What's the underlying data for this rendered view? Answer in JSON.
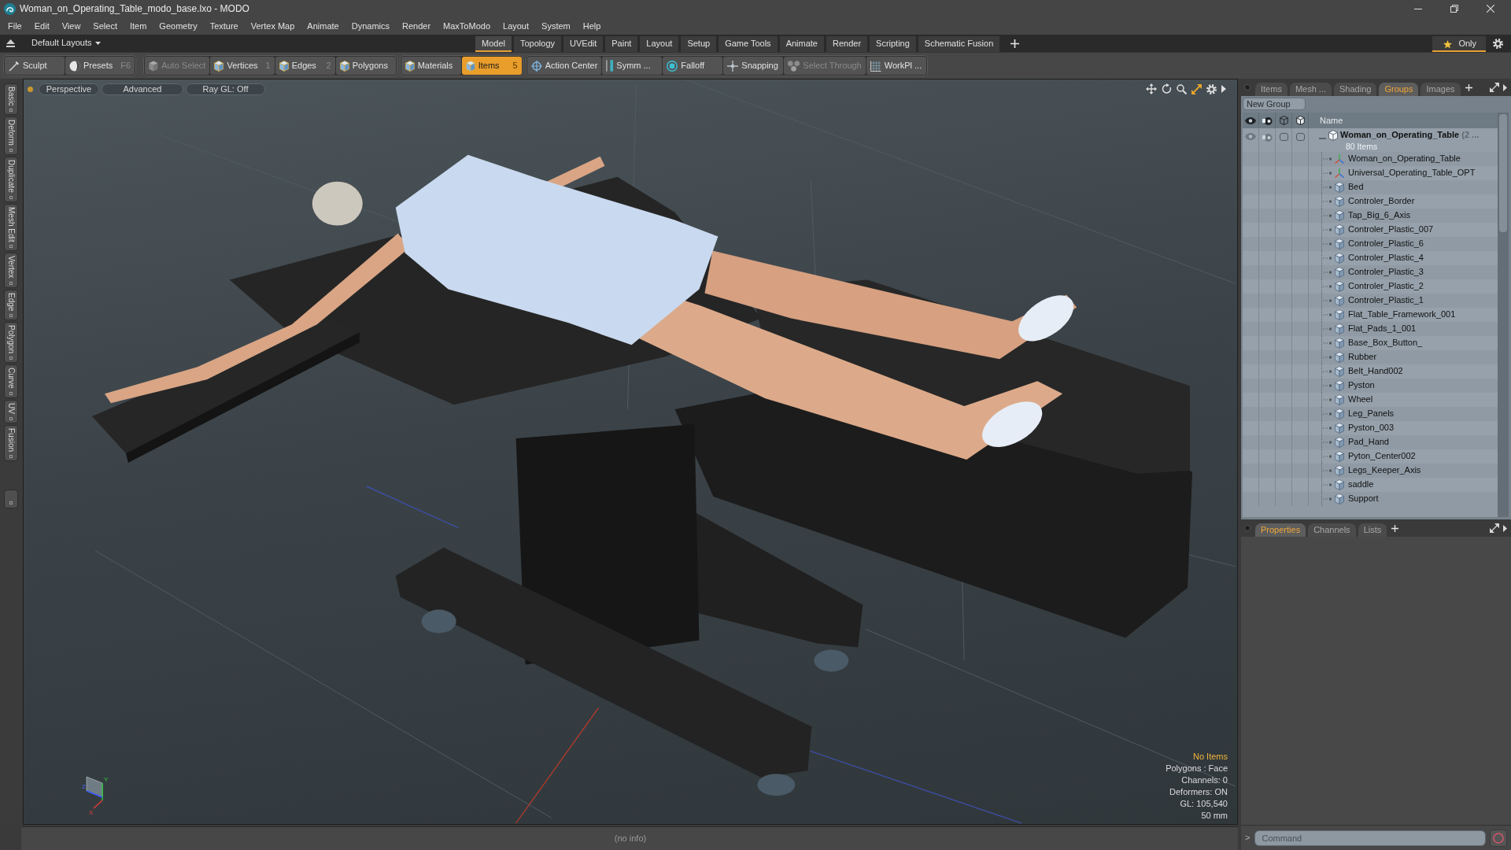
{
  "window": {
    "title": "Woman_on_Operating_Table_modo_base.lxo - MODO"
  },
  "menu": [
    "File",
    "Edit",
    "View",
    "Select",
    "Item",
    "Geometry",
    "Texture",
    "Vertex Map",
    "Animate",
    "Dynamics",
    "Render",
    "MaxToModo",
    "Layout",
    "System",
    "Help"
  ],
  "layout_bar": {
    "layouts": "Default Layouts",
    "tabs": [
      {
        "label": "Model",
        "selected": true
      },
      {
        "label": "Topology",
        "selected": false
      },
      {
        "label": "UVEdit",
        "selected": false
      },
      {
        "label": "Paint",
        "selected": false
      },
      {
        "label": "Layout",
        "selected": false
      },
      {
        "label": "Setup",
        "selected": false
      },
      {
        "label": "Game Tools",
        "selected": false
      },
      {
        "label": "Animate",
        "selected": false
      },
      {
        "label": "Render",
        "selected": false
      },
      {
        "label": "Scripting",
        "selected": false
      },
      {
        "label": "Schematic Fusion",
        "selected": false
      }
    ],
    "favorites": {
      "label": "Only",
      "selected": true
    }
  },
  "toolbar": [
    [
      {
        "label": "Sculpt",
        "kind": "brush",
        "selected": false,
        "disabled": false
      },
      {
        "label": "Presets",
        "shortcut": "F6",
        "kind": "sphere",
        "selected": false,
        "disabled": false
      }
    ],
    [
      {
        "label": "Auto Select",
        "kind": "cube",
        "selected": false,
        "disabled": true
      },
      {
        "label": "Vertices",
        "shortcut": "1",
        "kind": "cube",
        "selected": false,
        "disabled": false
      },
      {
        "label": "Edges",
        "shortcut": "2",
        "kind": "cube",
        "selected": false,
        "disabled": false
      },
      {
        "label": "Polygons",
        "kind": "cube",
        "selected": false,
        "disabled": false
      }
    ],
    [
      {
        "label": "Materials",
        "kind": "cube",
        "selected": false,
        "disabled": false
      },
      {
        "label": "Items",
        "shortcut": "5",
        "kind": "cube",
        "selected": true,
        "disabled": false
      }
    ],
    [
      {
        "label": "Action Center",
        "kind": "target",
        "selected": false,
        "disabled": false
      },
      {
        "label": "Symm ...",
        "kind": "symmetry",
        "selected": false,
        "disabled": false
      },
      {
        "label": "Falloff",
        "kind": "ring",
        "selected": false,
        "disabled": false
      },
      {
        "label": "Snapping",
        "kind": "snap",
        "selected": false,
        "disabled": false
      },
      {
        "label": "Select Through",
        "kind": "cubes",
        "selected": false,
        "disabled": true
      },
      {
        "label": "WorkPl ...",
        "kind": "grid",
        "selected": false,
        "disabled": false
      }
    ]
  ],
  "side_tabs": [
    "Basic",
    "Deform",
    "Duplicate",
    "Mesh Edit",
    "Vertex",
    "Edge",
    "Polygon",
    "Curve",
    "UV",
    "Fusion"
  ],
  "viewport": {
    "buttons": [
      "Perspective",
      "Advanced",
      "Ray GL: Off"
    ],
    "info": [
      {
        "text": "No Items",
        "kind": "selection"
      },
      {
        "text": "Polygons : Face",
        "kind": "plain"
      },
      {
        "text": "Channels: 0",
        "kind": "plain"
      },
      {
        "text": "Deformers: ON",
        "kind": "plain"
      },
      {
        "text": "GL: 105,540",
        "kind": "plain"
      },
      {
        "text": "50 mm",
        "kind": "plain"
      }
    ],
    "axes": [
      "Y",
      "Z",
      "X"
    ]
  },
  "status_bar": {
    "text": "(no info)"
  },
  "items_panel": {
    "tabs": [
      {
        "label": "Items",
        "selected": false
      },
      {
        "label": "Mesh ...",
        "selected": false
      },
      {
        "label": "Shading",
        "selected": false
      },
      {
        "label": "Groups",
        "selected": true
      },
      {
        "label": "Images",
        "selected": false
      }
    ],
    "new_group": "New Group",
    "name_column": "Name",
    "group": {
      "name": "Woman_on_Operating_Table",
      "suffix": "(2 ...",
      "count": "80 Items",
      "expanded": true,
      "children": [
        {
          "name": "Woman_on_Operating_Table",
          "kind": "locator"
        },
        {
          "name": "Universal_Operating_Table_OPT",
          "kind": "locator"
        },
        {
          "name": "Bed",
          "kind": "mesh"
        },
        {
          "name": "Controler_Border",
          "kind": "mesh"
        },
        {
          "name": "Tap_Big_6_Axis",
          "kind": "mesh"
        },
        {
          "name": "Controler_Plastic_007",
          "kind": "mesh"
        },
        {
          "name": "Controler_Plastic_6",
          "kind": "mesh"
        },
        {
          "name": "Controler_Plastic_4",
          "kind": "mesh"
        },
        {
          "name": "Controler_Plastic_3",
          "kind": "mesh"
        },
        {
          "name": "Controler_Plastic_2",
          "kind": "mesh"
        },
        {
          "name": "Controler_Plastic_1",
          "kind": "mesh"
        },
        {
          "name": "Flat_Table_Framework_001",
          "kind": "mesh"
        },
        {
          "name": "Flat_Pads_1_001",
          "kind": "mesh"
        },
        {
          "name": "Base_Box_Button_",
          "kind": "mesh"
        },
        {
          "name": "Rubber",
          "kind": "mesh"
        },
        {
          "name": "Belt_Hand002",
          "kind": "mesh"
        },
        {
          "name": "Pyston",
          "kind": "mesh"
        },
        {
          "name": "Wheel",
          "kind": "mesh"
        },
        {
          "name": "Leg_Panels",
          "kind": "mesh"
        },
        {
          "name": "Pyston_003",
          "kind": "mesh"
        },
        {
          "name": "Pad_Hand",
          "kind": "mesh"
        },
        {
          "name": "Pyton_Center002",
          "kind": "mesh"
        },
        {
          "name": "Legs_Keeper_Axis",
          "kind": "mesh"
        },
        {
          "name": "saddle",
          "kind": "mesh"
        },
        {
          "name": "Support",
          "kind": "mesh"
        }
      ]
    }
  },
  "properties_panel": {
    "tabs": [
      {
        "label": "Properties",
        "selected": true
      },
      {
        "label": "Channels",
        "selected": false
      },
      {
        "label": "Lists",
        "selected": false
      }
    ]
  },
  "command_bar": {
    "prompt": ">",
    "placeholder": "Command"
  }
}
